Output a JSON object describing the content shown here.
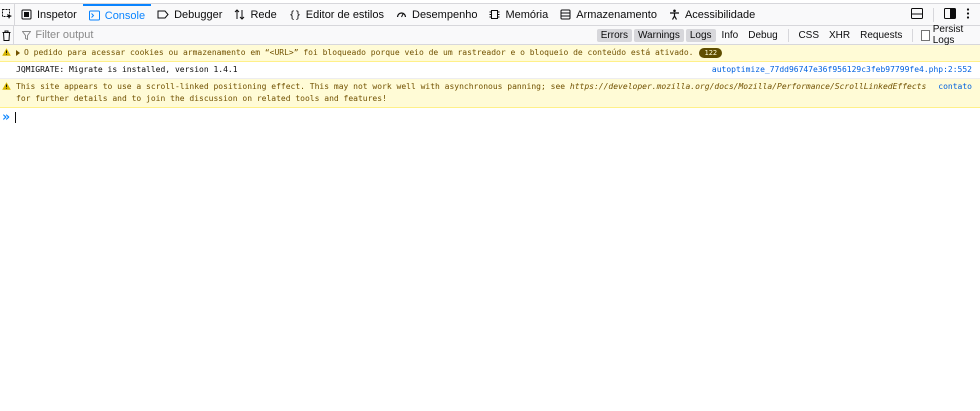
{
  "toolbar": {
    "tabs": [
      {
        "label": "Inspetor",
        "icon": "inspector-icon",
        "selected": false
      },
      {
        "label": "Console",
        "icon": "console-icon",
        "selected": true
      },
      {
        "label": "Debugger",
        "icon": "debugger-icon",
        "selected": false
      },
      {
        "label": "Rede",
        "icon": "network-icon",
        "selected": false
      },
      {
        "label": "Editor de estilos",
        "icon": "style-editor-icon",
        "selected": false
      },
      {
        "label": "Desempenho",
        "icon": "performance-icon",
        "selected": false
      },
      {
        "label": "Memória",
        "icon": "memory-icon",
        "selected": false
      },
      {
        "label": "Armazenamento",
        "icon": "storage-icon",
        "selected": false
      },
      {
        "label": "Acessibilidade",
        "icon": "accessibility-icon",
        "selected": false
      }
    ],
    "accent_color": "#0a84ff"
  },
  "filterbar": {
    "placeholder": "Filter output",
    "buttons": [
      {
        "label": "Errors",
        "on": true
      },
      {
        "label": "Warnings",
        "on": true
      },
      {
        "label": "Logs",
        "on": true
      },
      {
        "label": "Info",
        "on": false
      },
      {
        "label": "Debug",
        "on": false
      },
      {
        "label": "CSS",
        "on": false
      },
      {
        "label": "XHR",
        "on": false
      },
      {
        "label": "Requests",
        "on": false
      }
    ],
    "persist_label": "Persist Logs",
    "persist_checked": false
  },
  "messages": {
    "cookie_warning": {
      "text": "O pedido para acessar cookies ou armazenamento em “<URL>” foi bloqueado porque veio de um rastreador e o bloqueio de conteúdo está ativado.",
      "count": "122"
    },
    "jqmigrate": {
      "text": "JQMIGRATE: Migrate is installed, version 1.4.1",
      "source": "autoptimize_77dd96747e36f956129c3feb97799fe4.php:2:552"
    },
    "scroll_warning": {
      "text_before": "This site appears to use a scroll-linked positioning effect. This may not work well with asynchronous panning; see ",
      "url": "https://developer.mozilla.org/docs/Mozilla/Performance/ScrollLinkedEffects",
      "text_after": " for further details and to join the discussion on related tools and features!",
      "source": "contato"
    }
  },
  "colors": {
    "warning_bg": "#fffbd6",
    "warning_text": "#715100",
    "link": "#0060df"
  }
}
